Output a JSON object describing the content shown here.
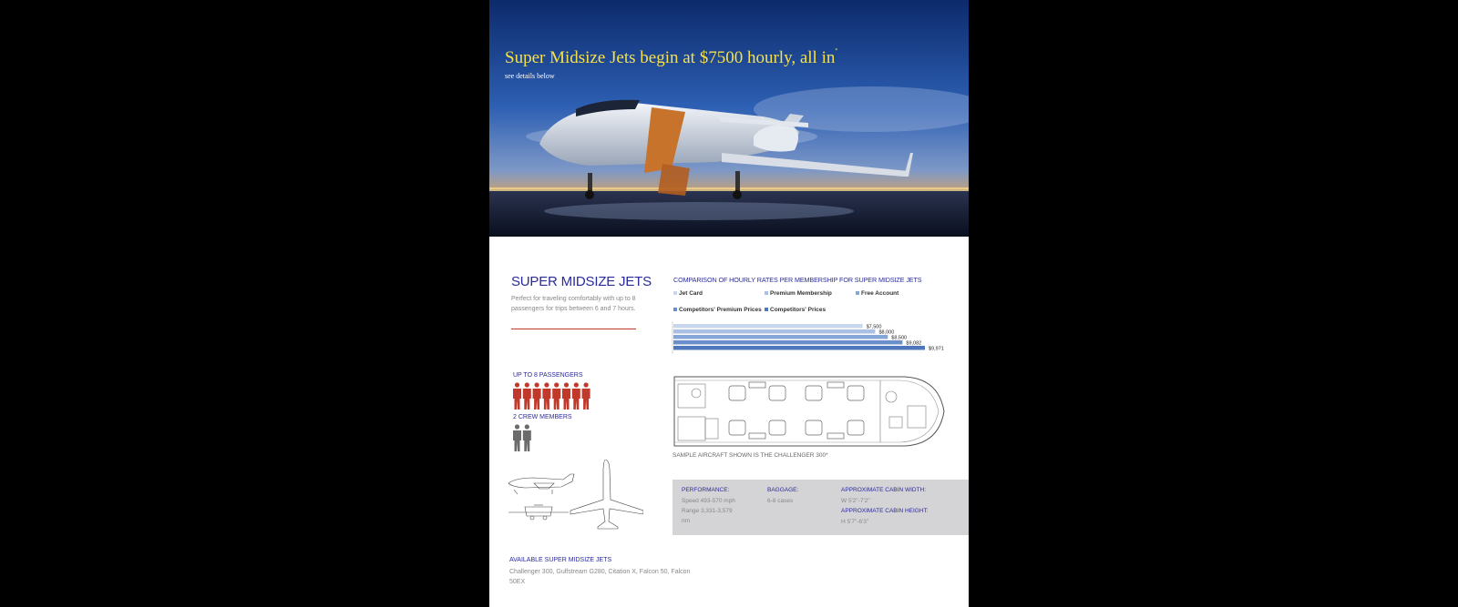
{
  "hero": {
    "headline": "Super Midsize Jets begin at $7500 hourly, all in",
    "headline_mark": "*",
    "subhead": "see details below"
  },
  "section": {
    "title": "SUPER MIDSIZE JETS",
    "description": "Perfect for traveling comfortably with up to 8 passengers for trips between 6 and 7 hours."
  },
  "chart_data": {
    "type": "bar",
    "title": "COMPARISON OF HOURLY RATES PER MEMBERSHIP FOR SUPER MIDSIZE JETS",
    "categories": [
      "Jet Card",
      "Premium Membership",
      "Free Account",
      "Competitors' Premium Prices",
      "Competitors' Prices"
    ],
    "value_labels": [
      "$7,500",
      "$8,000",
      "$8,500",
      "$9,082",
      "$9,971"
    ],
    "values": [
      7500,
      8000,
      8500,
      9082,
      9971
    ],
    "colors": [
      "#c9d7ee",
      "#a9c0e4",
      "#86a6d8",
      "#6a8fcb",
      "#4f77bb"
    ],
    "orientation": "horizontal",
    "legend": "top"
  },
  "capacity": {
    "passengers_label": "UP TO 8 PASSENGERS",
    "passengers_count": 8,
    "crew_label": "2 CREW MEMBERS",
    "crew_count": 2
  },
  "floorplan": {
    "caption": "SAMPLE AIRCRAFT SHOWN IS THE CHALLENGER 300*"
  },
  "specs": {
    "performance_label": "PERFORMANCE:",
    "speed": "Speed 493-570 mph",
    "range": "Range 3,331-3,579",
    "range_unit": "nm",
    "baggage_label": "BAGGAGE:",
    "baggage_value": "6-8 cases",
    "width_label": "APPROXIMATE CABIN WIDTH:",
    "width_value": "W 5'2\"-7'2\"",
    "height_label": "APPROXIMATE CABIN HEIGHT:",
    "height_value": "H 5'7\"-6'3\""
  },
  "available": {
    "title": "AVAILABLE SUPER MIDSIZE JETS",
    "list": "Challenger 300, Gulfstream G280, Citation X, Falcon 50, Falcon 50EX"
  },
  "colors": {
    "navy_text": "#2a2a9a",
    "headline_yellow": "#f4e04d",
    "passenger_red": "#c0392b",
    "crew_grey": "#6b6b6b",
    "spec_bg": "#d4d4d6"
  }
}
